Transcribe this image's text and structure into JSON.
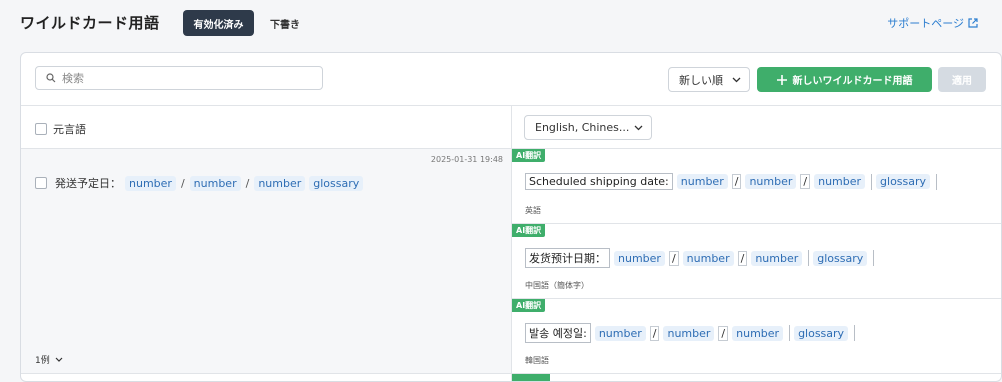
{
  "header": {
    "title": "ワイルドカード用語",
    "tabs": [
      "有効化済み",
      "下書き"
    ],
    "support_link": "サポートページ"
  },
  "toolbar": {
    "search_placeholder": "検索",
    "sort_label": "新しい順",
    "add_label": "新しいワイルドカード用語",
    "apply_label": "適用"
  },
  "columns": {
    "source_header": "元言語",
    "language_select": "English, Chines..."
  },
  "entry": {
    "timestamp": "2025-01-31 19:48",
    "source_prefix": "発送予定日：",
    "tokens": [
      "number",
      "number",
      "number",
      "glossary"
    ],
    "count_label": "1例",
    "translations": [
      {
        "badge": "AI翻訳",
        "prefix": "Scheduled shipping date:",
        "tokens": [
          "number",
          "number",
          "number",
          "glossary"
        ],
        "language": "英語"
      },
      {
        "badge": "AI翻訳",
        "prefix": "发货预计日期：",
        "tokens": [
          "number",
          "number",
          "number",
          "glossary"
        ],
        "language": "中国語（簡体字）"
      },
      {
        "badge": "AI翻訳",
        "prefix": "발송 예정일:",
        "tokens": [
          "number",
          "number",
          "number",
          "glossary"
        ],
        "language": "韓国語"
      }
    ]
  }
}
